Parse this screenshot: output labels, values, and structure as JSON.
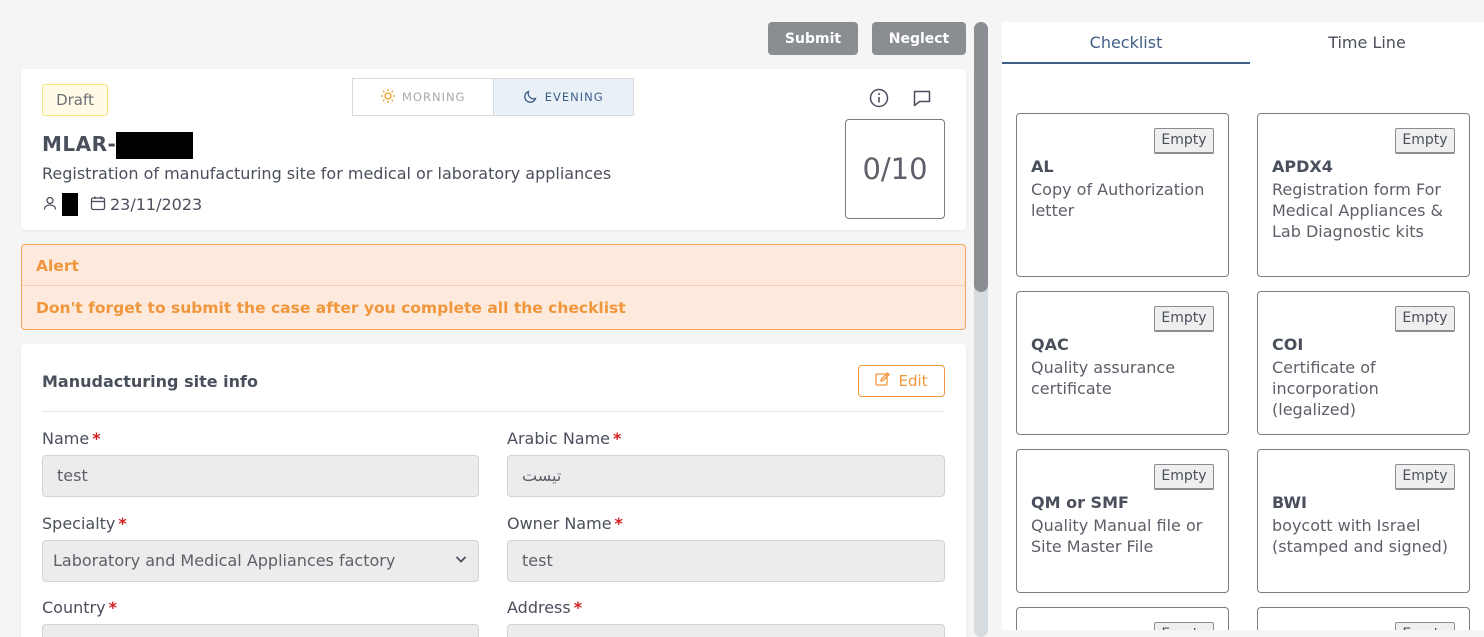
{
  "actions": {
    "submit_label": "Submit",
    "neglect_label": "Neglect"
  },
  "case": {
    "status": "Draft",
    "shift": {
      "morning_label": "MORNING",
      "evening_label": "EVENING",
      "selected": "EVENING"
    },
    "id_prefix": "MLAR-",
    "description": "Registration of manufacturing site for medical or laboratory appliances",
    "date": "23/11/2023",
    "progress": "0/10"
  },
  "alert": {
    "title": "Alert",
    "message": "Don't forget to submit the case after you complete all the checklist"
  },
  "site_info": {
    "title": "Manudacturing site info",
    "edit_label": "Edit",
    "fields": {
      "name": {
        "label": "Name",
        "value": "test"
      },
      "arabic_name": {
        "label": "Arabic Name",
        "value": "تيست"
      },
      "specialty": {
        "label": "Specialty",
        "value": "Laboratory and Medical Appliances factory"
      },
      "owner_name": {
        "label": "Owner Name",
        "value": "test"
      },
      "country": {
        "label": "Country"
      },
      "address": {
        "label": "Address"
      }
    },
    "required_mark": "*"
  },
  "right_panel": {
    "tabs": [
      {
        "label": "Checklist",
        "active": true
      },
      {
        "label": "Time Line",
        "active": false
      }
    ],
    "checklist": [
      {
        "badge": "Empty",
        "code": "AL",
        "name": "Copy of Authorization letter"
      },
      {
        "badge": "Empty",
        "code": "APDX4",
        "name": "Registration form For Medical Appliances & Lab Diagnostic kits"
      },
      {
        "badge": "Empty",
        "code": "QAC",
        "name": "Quality assurance certificate"
      },
      {
        "badge": "Empty",
        "code": "COI",
        "name": "Certificate of incorporation (legalized)"
      },
      {
        "badge": "Empty",
        "code": "QM or SMF",
        "name": "Quality Manual file or Site Master File"
      },
      {
        "badge": "Empty",
        "code": "BWI",
        "name": "boycott with Israel (stamped and signed)"
      },
      {
        "badge": "Empty"
      },
      {
        "badge": "Empty"
      }
    ]
  },
  "colors": {
    "accent": "#3f5e86",
    "warning": "#f0963d",
    "required": "#d01f1f",
    "button_gray": "#8a8d92"
  },
  "icons": [
    "sun-icon",
    "moon-icon",
    "info-icon",
    "comment-icon",
    "user-icon",
    "calendar-icon",
    "edit-icon",
    "chevron-down-icon"
  ]
}
